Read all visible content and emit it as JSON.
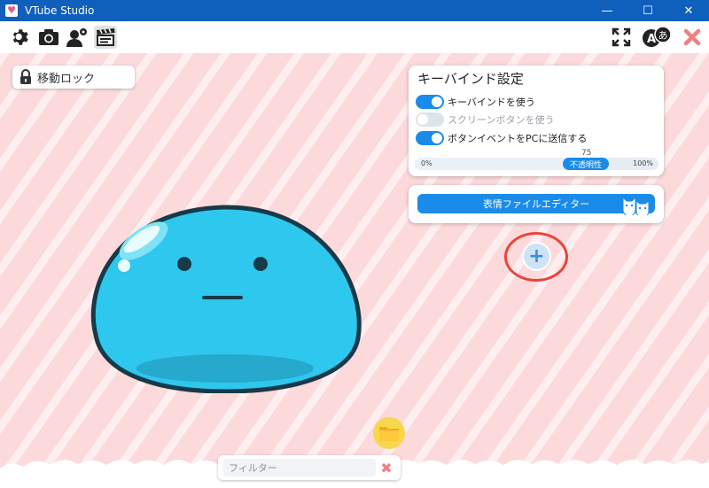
{
  "window": {
    "title": "VTube Studio",
    "minimize": "—",
    "maximize": "☐",
    "close": "✕"
  },
  "toolbar": {
    "left_icons": [
      "gear-icon",
      "camera-icon",
      "user-settings-icon",
      "clapperboard-icon"
    ],
    "right_icons": [
      "fullscreen-icon",
      "language-icon",
      "close-icon"
    ]
  },
  "move_lock": {
    "label": "移動ロック"
  },
  "keybind_panel": {
    "title": "キーバインド設定",
    "toggles": [
      {
        "label": "キーバインドを使う",
        "on": true
      },
      {
        "label": "スクリーンボタンを使う",
        "on": false
      },
      {
        "label": "ボタンイベントをPCに送信する",
        "on": true
      }
    ],
    "opacity": {
      "label": "不透明性",
      "value": "75",
      "min_label": "0%",
      "max_label": "100%",
      "fraction": 0.75
    }
  },
  "expression_editor": {
    "label": "表情ファイルエディター"
  },
  "add_button": {
    "symbol": "+"
  },
  "filter": {
    "placeholder": "フィルター",
    "value": "",
    "clear": "✖"
  },
  "colors": {
    "titlebar": "#0f5fbd",
    "accent": "#1a8be8",
    "background_pink": "#fcd9db",
    "highlight_ring": "#e8453c",
    "slime": "#2ec7ee"
  }
}
